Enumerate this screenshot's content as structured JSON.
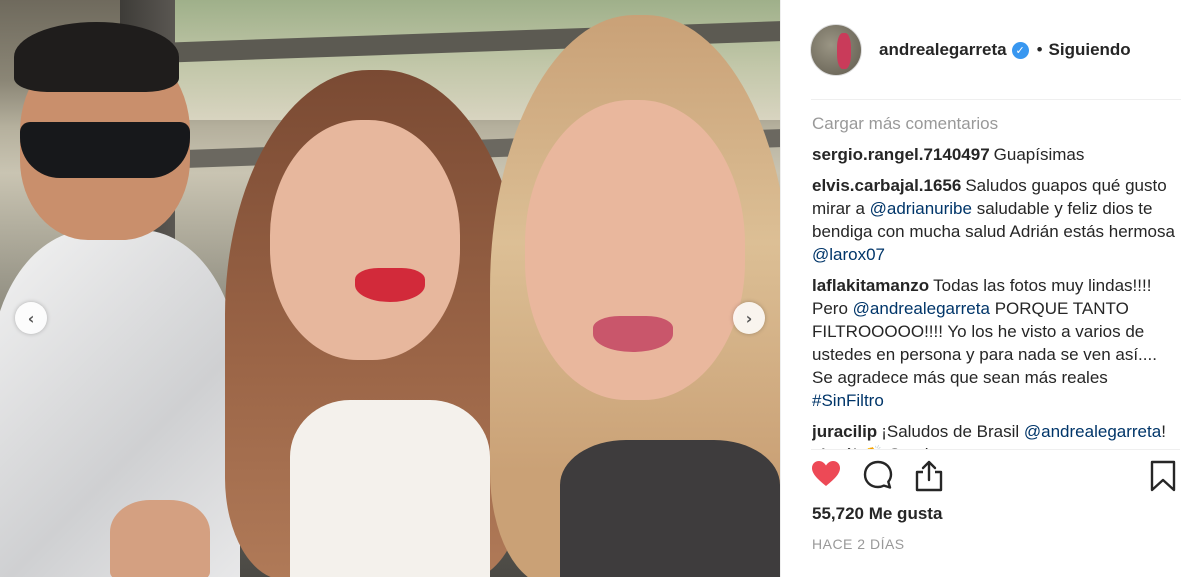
{
  "post": {
    "username": "andrealegarreta",
    "verified": true,
    "separator_dot": "•",
    "follow_label": "Siguiendo",
    "nav_prev_glyph": "‹",
    "nav_next_glyph": "›"
  },
  "comments": {
    "load_more": "Cargar más comentarios",
    "items": [
      {
        "user": "sergio.rangel.7140497",
        "text": "Guapísimas"
      },
      {
        "user": "elvis.carbajal.1656",
        "text_before": "Saludos guapos qué gusto mirar a",
        "mention_1": "@adrianuribe",
        "text_middle": "saludable y feliz dios te bendiga con mucha salud Adrián estás hermosa",
        "mention_2": "@larox07"
      },
      {
        "user": "laflakitamanzo",
        "text_before": "Todas las fotos muy lindas!!!! Pero",
        "mention_1": "@andrealegarreta",
        "text_middle": "PORQUE TANTO FILTROOOOO!!!! Yo los he visto a varios de ustedes en persona y para nada se ven así.... Se agradece más que sean más reales",
        "hashtag": "#SinFiltro"
      },
      {
        "user": "juracilip",
        "text_before": "¡Saludos de Brasil",
        "mention_1": "@andrealegarreta",
        "text_after": "! ¡Amé! 👏 Gracias"
      }
    ]
  },
  "actions": {
    "like_icon": "heart-filled-icon",
    "comment_icon": "speech-bubble-icon",
    "share_icon": "share-upload-icon",
    "save_icon": "bookmark-icon",
    "like_color": "#ed4956"
  },
  "stats": {
    "likes": "55,720 Me gusta",
    "time_ago": "HACE 2 DÍAS"
  }
}
